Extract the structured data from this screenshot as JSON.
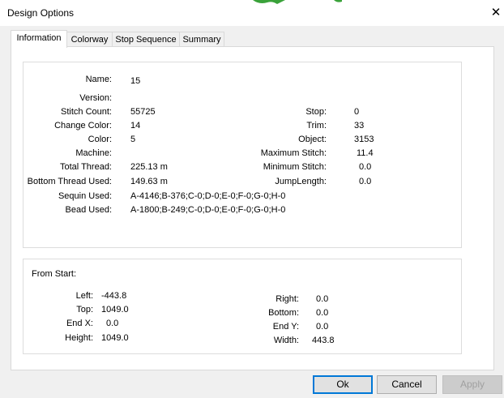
{
  "window": {
    "title": "Design Options"
  },
  "tabs": [
    {
      "label": "Information",
      "active": true
    },
    {
      "label": "Colorway",
      "active": false
    },
    {
      "label": "Stop Sequence",
      "active": false
    },
    {
      "label": "Summary",
      "active": false
    }
  ],
  "info": {
    "name": {
      "label": "Name:",
      "value": "15"
    },
    "version": {
      "label": "Version:",
      "value": ""
    },
    "stitch_count": {
      "label": "Stitch Count:",
      "value": "55725"
    },
    "change_color": {
      "label": "Change Color:",
      "value": "14"
    },
    "color": {
      "label": "Color:",
      "value": "5"
    },
    "machine": {
      "label": "Machine:",
      "value": ""
    },
    "total_thread": {
      "label": "Total Thread:",
      "value": "225.13 m"
    },
    "bottom_thread": {
      "label": "Bottom Thread Used:",
      "value": "149.63 m"
    },
    "sequin_used": {
      "label": "Sequin Used:",
      "value": "A-4146;B-376;C-0;D-0;E-0;F-0;G-0;H-0"
    },
    "bead_used": {
      "label": "Bead Used:",
      "value": "A-1800;B-249;C-0;D-0;E-0;F-0;G-0;H-0"
    },
    "stop": {
      "label": "Stop:",
      "value": "0"
    },
    "trim": {
      "label": "Trim:",
      "value": "33"
    },
    "object": {
      "label": "Object:",
      "value": "3153"
    },
    "max_stitch": {
      "label": "Maximum Stitch:",
      "value": "11.4"
    },
    "min_stitch": {
      "label": "Minimum Stitch:",
      "value": "0.0"
    },
    "jump_length": {
      "label": "JumpLength:",
      "value": "0.0"
    }
  },
  "from_start": {
    "heading": "From Start:",
    "left": {
      "label": "Left:",
      "value": "-443.8"
    },
    "top": {
      "label": "Top:",
      "value": "1049.0"
    },
    "end_x": {
      "label": "End X:",
      "value": "0.0"
    },
    "height": {
      "label": "Height:",
      "value": "1049.0"
    },
    "right": {
      "label": "Right:",
      "value": "0.0"
    },
    "bottom": {
      "label": "Bottom:",
      "value": "0.0"
    },
    "end_y": {
      "label": "End Y:",
      "value": "0.0"
    },
    "width": {
      "label": "Width:",
      "value": "443.8"
    }
  },
  "buttons": {
    "ok": "Ok",
    "cancel": "Cancel",
    "apply": "Apply"
  },
  "icons": {
    "close": "close-icon"
  },
  "colors": {
    "accent": "#0078d7",
    "deco_green": "#3aa23a"
  }
}
